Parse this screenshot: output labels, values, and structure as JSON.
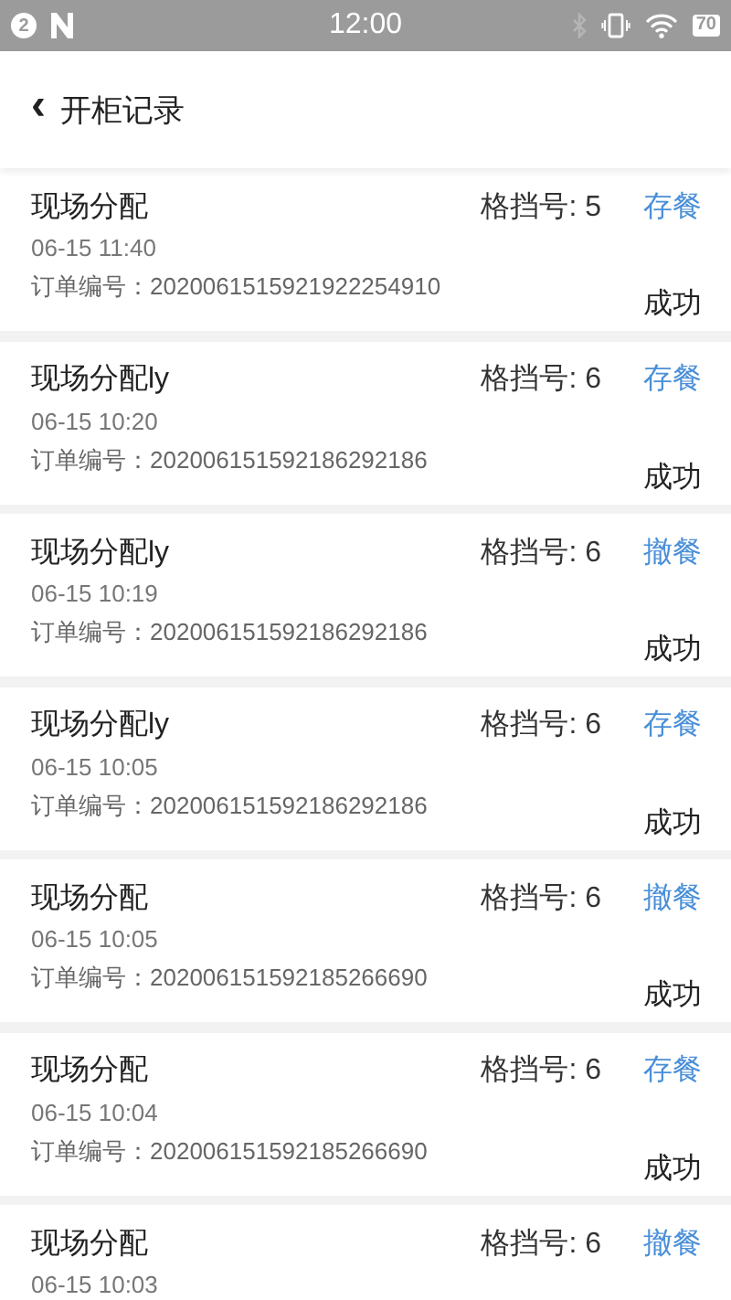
{
  "status_bar": {
    "notification_count": "2",
    "time": "12:00",
    "battery": "70"
  },
  "header": {
    "back": "‹",
    "title": "开柜记录"
  },
  "records": [
    {
      "name": "现场分配",
      "slot": "格挡号: 5",
      "action": "存餐",
      "time": "06-15 11:40",
      "order": "订单编号：2020061515921922254910",
      "result": "成功"
    },
    {
      "name": "现场分配ly",
      "slot": "格挡号: 6",
      "action": "存餐",
      "time": "06-15 10:20",
      "order": "订单编号：202006151592186292186",
      "result": "成功"
    },
    {
      "name": "现场分配ly",
      "slot": "格挡号: 6",
      "action": "撤餐",
      "time": "06-15 10:19",
      "order": "订单编号：202006151592186292186",
      "result": "成功"
    },
    {
      "name": "现场分配ly",
      "slot": "格挡号: 6",
      "action": "存餐",
      "time": "06-15 10:05",
      "order": "订单编号：202006151592186292186",
      "result": "成功"
    },
    {
      "name": "现场分配",
      "slot": "格挡号: 6",
      "action": "撤餐",
      "time": "06-15 10:05",
      "order": "订单编号：202006151592185266690",
      "result": "成功"
    },
    {
      "name": "现场分配",
      "slot": "格挡号: 6",
      "action": "存餐",
      "time": "06-15 10:04",
      "order": "订单编号：202006151592185266690",
      "result": "成功"
    },
    {
      "name": "现场分配",
      "slot": "格挡号: 6",
      "action": "撤餐",
      "time": "06-15 10:03"
    }
  ]
}
